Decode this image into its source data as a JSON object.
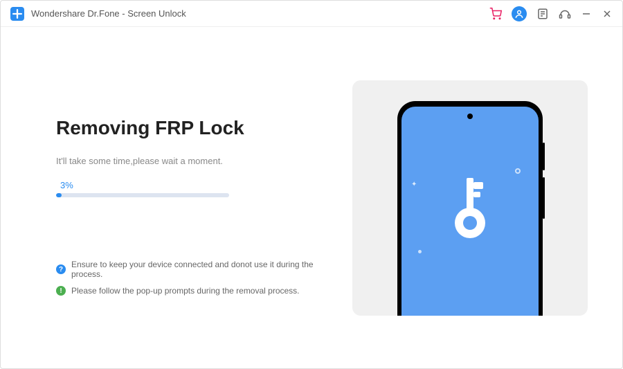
{
  "titlebar": {
    "title": "Wondershare Dr.Fone - Screen Unlock"
  },
  "main": {
    "heading": "Removing FRP Lock",
    "subtext": "It'll take some time,please wait a moment.",
    "progress": {
      "percent_label": "3%",
      "percent_value": 3
    },
    "notes": [
      {
        "icon": "question",
        "text": "Ensure to keep your device connected and  donot use it  during the process."
      },
      {
        "icon": "info",
        "text": "Please follow the pop-up prompts during the removal process."
      }
    ]
  },
  "colors": {
    "accent": "#2a8cf0",
    "screen": "#5c9ff2"
  }
}
